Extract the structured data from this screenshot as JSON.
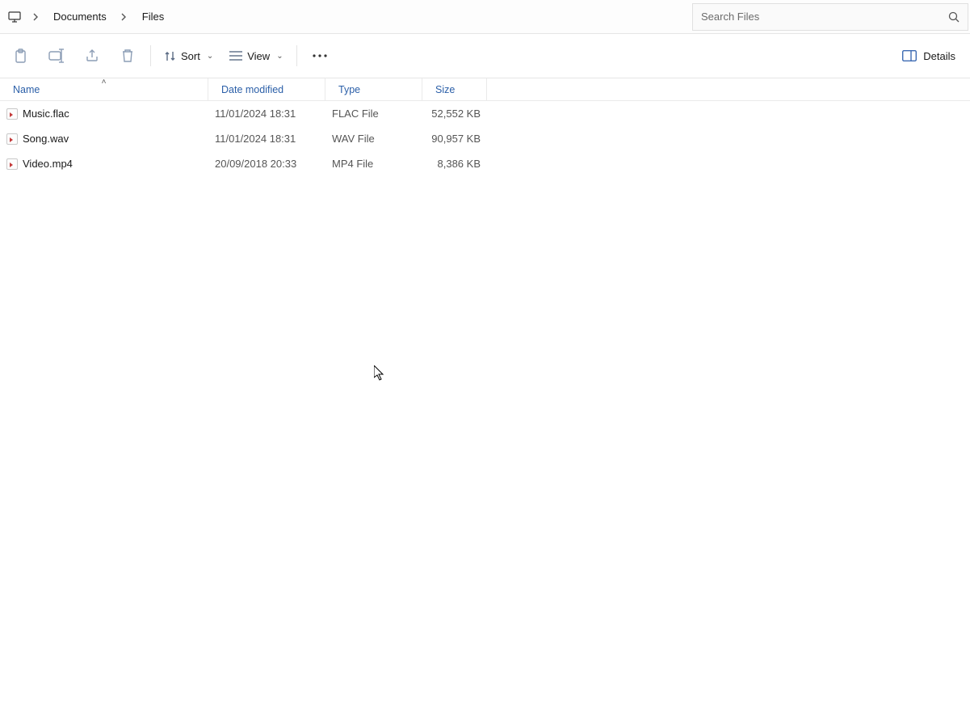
{
  "breadcrumb": {
    "segments": [
      "Documents",
      "Files"
    ]
  },
  "search": {
    "placeholder": "Search Files"
  },
  "toolbar": {
    "sort_label": "Sort",
    "view_label": "View",
    "details_label": "Details"
  },
  "columns": {
    "name": "Name",
    "date": "Date modified",
    "type": "Type",
    "size": "Size",
    "sorted_by": "name",
    "sort_dir_glyph": "˄"
  },
  "files": [
    {
      "name": "Music.flac",
      "date": "11/01/2024 18:31",
      "type": "FLAC File",
      "size": "52,552 KB"
    },
    {
      "name": "Song.wav",
      "date": "11/01/2024 18:31",
      "type": "WAV File",
      "size": "90,957 KB"
    },
    {
      "name": "Video.mp4",
      "date": "20/09/2018 20:33",
      "type": "MP4 File",
      "size": "8,386 KB"
    }
  ]
}
